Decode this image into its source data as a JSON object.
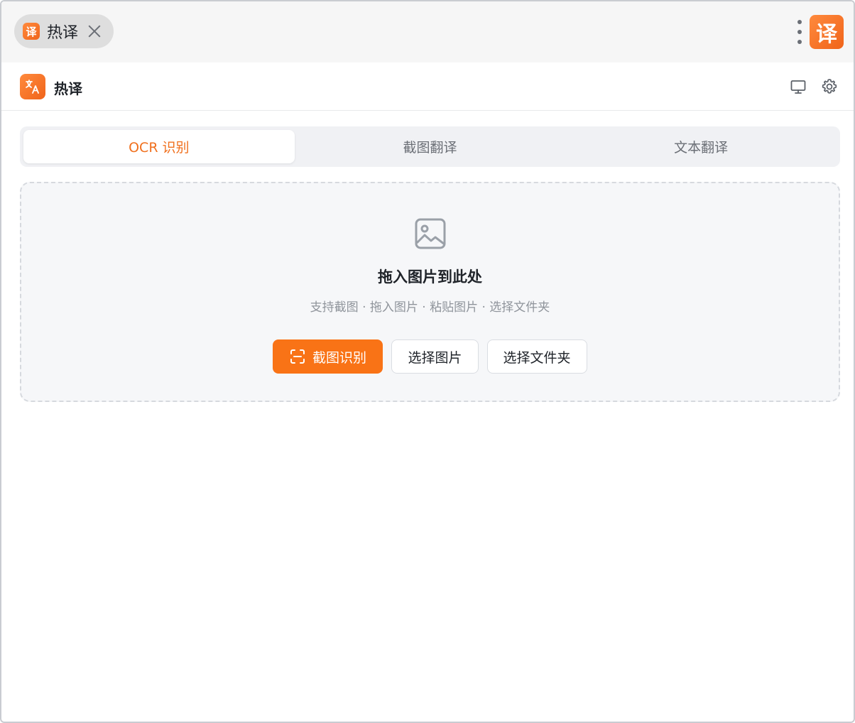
{
  "titlebar": {
    "tab_icon_glyph": "译",
    "tab_label": "热译",
    "close_icon": "close-icon",
    "menu_icon": "more-vertical-icon",
    "extension_icon_glyph": "译"
  },
  "header": {
    "logo_icon": "translate-icon",
    "title": "热译",
    "monitor_icon": "monitor-icon",
    "settings_icon": "gear-icon"
  },
  "tabs": [
    {
      "label": "OCR 识别",
      "active": true
    },
    {
      "label": "截图翻译",
      "active": false
    },
    {
      "label": "文本翻译",
      "active": false
    }
  ],
  "dropzone": {
    "icon": "image-icon",
    "title": "拖入图片到此处",
    "subtitle": "支持截图 · 拖入图片 · 粘贴图片 · 选择文件夹",
    "buttons": {
      "capture": "截图识别",
      "choose_image": "选择图片",
      "choose_folder": "选择文件夹"
    }
  },
  "colors": {
    "accent": "#f97316",
    "accent_text": "#f0701e",
    "muted_text": "#8f949b"
  }
}
